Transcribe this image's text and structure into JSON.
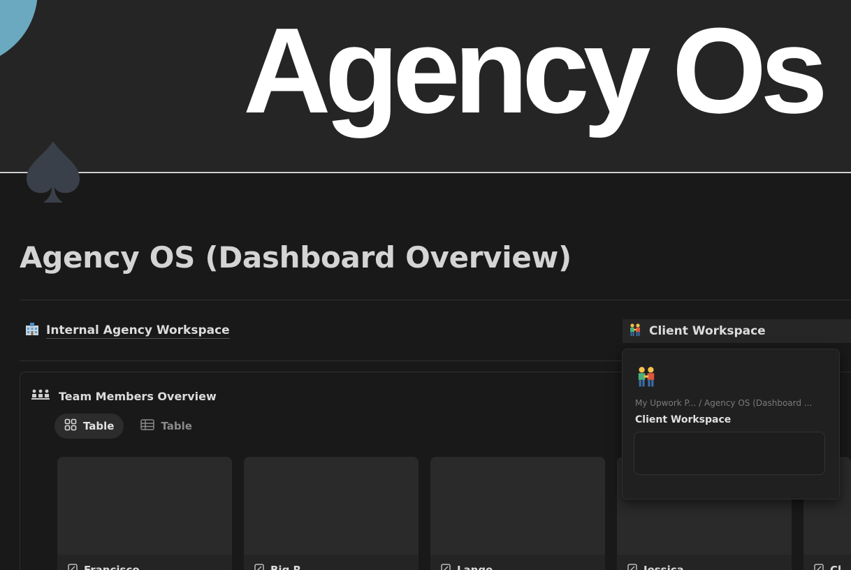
{
  "cover": {
    "title": "Agency Os",
    "circle_color": "#6aa9c0"
  },
  "page": {
    "icon": "spade-icon",
    "title": "Agency OS (Dashboard Overview)"
  },
  "links": {
    "internal": {
      "icon": "office-building-icon",
      "label": "Internal Agency Workspace"
    },
    "client": {
      "icon": "people-holding-hands-icon",
      "label": "Client Workspace"
    }
  },
  "database": {
    "icon": "team-members-icon",
    "title": "Team Members Overview",
    "views": [
      {
        "icon": "gallery-icon",
        "label": "Table",
        "active": true
      },
      {
        "icon": "table-icon",
        "label": "Table",
        "active": false
      }
    ],
    "cards": [
      {
        "label": "Francisco"
      },
      {
        "label": "Big R"
      },
      {
        "label": "Lange"
      },
      {
        "label": "Jessica"
      },
      {
        "label": "Cl"
      }
    ]
  },
  "popup": {
    "breadcrumb": "My Upwork P...  /  Agency OS (Dashboard ...",
    "title": "Client Workspace"
  }
}
